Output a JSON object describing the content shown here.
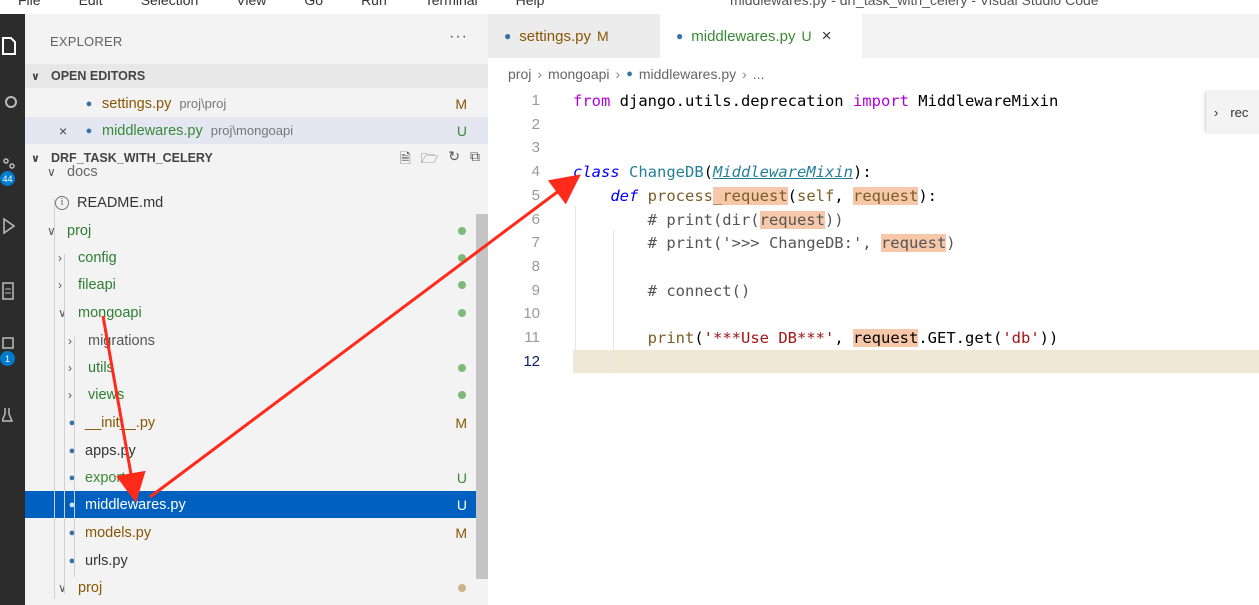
{
  "window": {
    "menu": [
      "File",
      "Edit",
      "Selection",
      "View",
      "Go",
      "Run",
      "Terminal",
      "Help"
    ],
    "title": "middlewares.py - drf_task_with_celery - Visual Studio Code"
  },
  "activity_bar": {
    "badges": [
      "44",
      "1"
    ]
  },
  "sidebar": {
    "header": "EXPLORER",
    "more": "···",
    "open_editors": {
      "label": "OPEN EDITORS",
      "items": [
        {
          "name": "settings.py",
          "path": "proj\\proj",
          "status": "M"
        },
        {
          "name": "middlewares.py",
          "path": "proj\\mongoapi",
          "status": "U",
          "close": "×"
        }
      ]
    },
    "workspace": {
      "label": "DRF_TASK_WITH_CELERY",
      "tree": [
        {
          "label": "docs",
          "kind": "folder"
        },
        {
          "label": "README.md",
          "kind": "info"
        },
        {
          "label": "proj",
          "kind": "folder"
        },
        {
          "label": "config",
          "kind": "folder-closed"
        },
        {
          "label": "fileapi",
          "kind": "folder-closed"
        },
        {
          "label": "mongoapi",
          "kind": "folder"
        },
        {
          "label": "migrations",
          "kind": "folder-closed"
        },
        {
          "label": "utils",
          "kind": "folder-closed"
        },
        {
          "label": "views",
          "kind": "folder-closed"
        },
        {
          "label": "__init__.py",
          "kind": "py",
          "status": "M"
        },
        {
          "label": "apps.py",
          "kind": "py"
        },
        {
          "label": "export.py",
          "kind": "py",
          "status": "U"
        },
        {
          "label": "middlewares.py",
          "kind": "py",
          "status": "U"
        },
        {
          "label": "models.py",
          "kind": "py",
          "status": "M"
        },
        {
          "label": "urls.py",
          "kind": "py"
        },
        {
          "label": "proj",
          "kind": "folder"
        }
      ]
    }
  },
  "editor": {
    "tabs": [
      {
        "label": "settings.py",
        "state": "M"
      },
      {
        "label": "middlewares.py",
        "state": "U",
        "close": "×"
      }
    ],
    "breadcrumb": [
      "proj",
      "mongoapi",
      "middlewares.py",
      "..."
    ],
    "line_numbers": [
      "1",
      "2",
      "3",
      "4",
      "5",
      "6",
      "7",
      "8",
      "9",
      "10",
      "11",
      "12"
    ],
    "widget_text": "rec",
    "code": {
      "l1_from": "from",
      "l1_mod": " django.utils.deprecation ",
      "l1_import": "import",
      "l1_name": " MiddlewareMixin",
      "l4_class": "class",
      "l4_name": "ChangeDB",
      "l4_open": "(",
      "l4_base": "MiddlewareMixin",
      "l4_close": "):",
      "l5_def": "def",
      "l5_fn1": "process",
      "l5_fn2": "_request",
      "l5_open": "(",
      "l5_self": "self",
      "l5_comma": ", ",
      "l5_req": "request",
      "l5_close": "):",
      "l6_a": "# print(dir(",
      "l6_req": "request",
      "l6_b": "))",
      "l7_a": "# print('>>> ChangeDB:', ",
      "l7_req": "request",
      "l7_b": ")",
      "l9": "# connect()",
      "l11_print": "print",
      "l11_open": "(",
      "l11_str": "'***Use DB***'",
      "l11_comma": ", ",
      "l11_req": "request",
      "l11_get": ".GET.get(",
      "l11_str2": "'db'",
      "l11_close": "))"
    }
  }
}
